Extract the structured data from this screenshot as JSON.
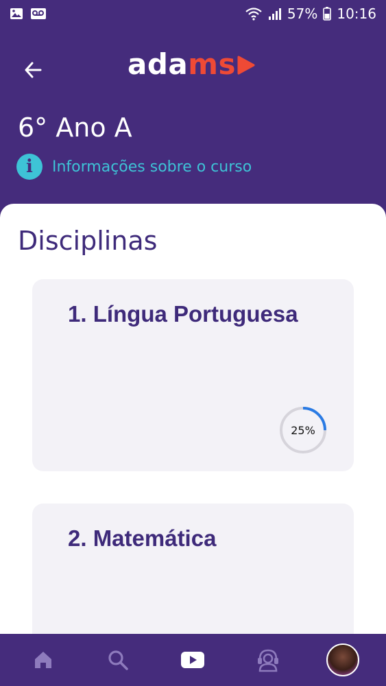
{
  "status_bar": {
    "battery": "57%",
    "time": "10:16"
  },
  "header": {
    "logo_part1": "ada",
    "logo_part2": "ms",
    "course_title": "6° Ano A",
    "info_link": "Informações sobre o curso"
  },
  "section": {
    "title": "Disciplinas"
  },
  "disciplines": [
    {
      "title": "1. Língua Portuguesa",
      "progress": 25,
      "progress_label": "25%"
    },
    {
      "title": "2. Matemática"
    }
  ],
  "icons": {
    "back": "arrow-left-icon",
    "info": "info-icon",
    "home": "home-icon",
    "search": "search-icon",
    "video": "play-icon",
    "support": "headset-icon"
  },
  "colors": {
    "primary": "#452c7c",
    "accent": "#ef4a35",
    "info": "#3ec3d6",
    "progress": "#2a7be4",
    "card_bg": "#f3f2f7"
  }
}
